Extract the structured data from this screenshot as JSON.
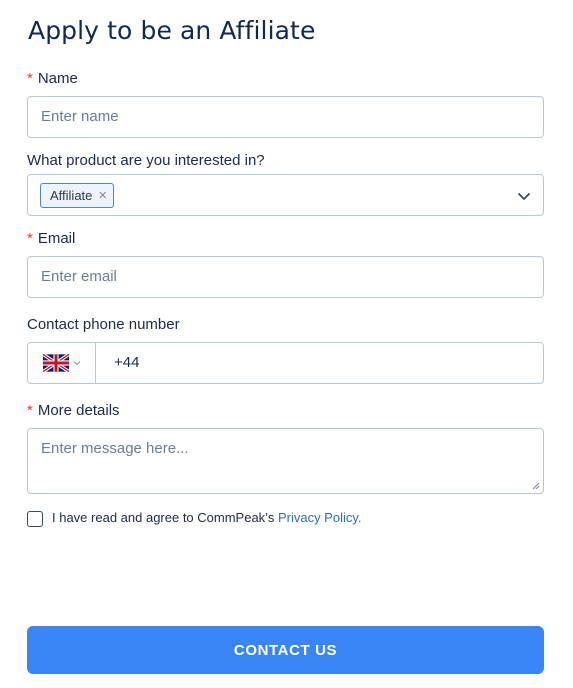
{
  "title": "Apply to be an Affiliate",
  "required_mark": "*",
  "name": {
    "label": "Name",
    "placeholder": "Enter name"
  },
  "product": {
    "label": "What product are you interested in?",
    "selected_tag": "Affiliate",
    "remove_glyph": "×",
    "icon": "chevron-down-icon"
  },
  "email": {
    "label": "Email",
    "placeholder": "Enter email"
  },
  "phone": {
    "label": "Contact phone number",
    "country_flag": "uk-flag-icon",
    "value": "+44"
  },
  "details": {
    "label": "More details",
    "placeholder": "Enter message here..."
  },
  "consent": {
    "text": "I have read and agree to CommPeak’s ",
    "link_text": "Privacy Policy.",
    "checked": false
  },
  "submit": {
    "label": "CONTACT US",
    "color": "#3a86f7"
  }
}
